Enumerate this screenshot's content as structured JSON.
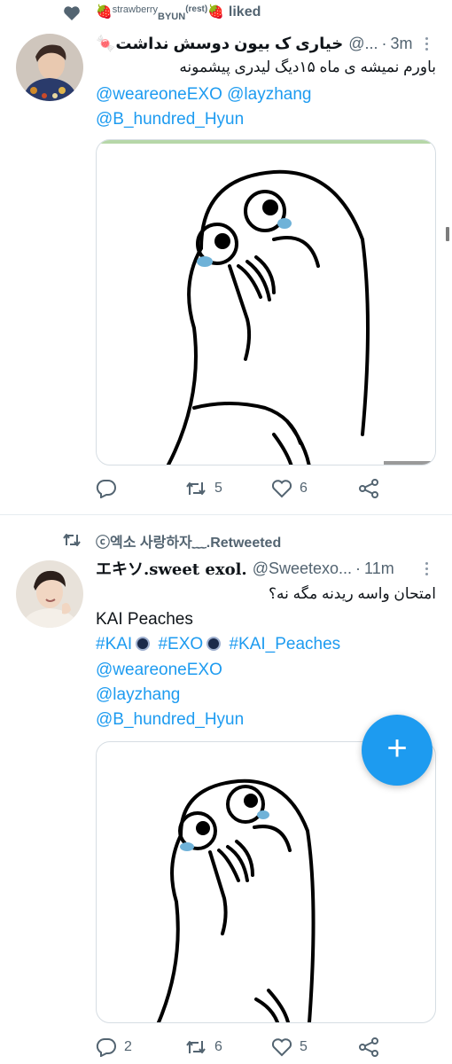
{
  "liked_context": {
    "icon": "heart-icon",
    "text_pre": "strawberry",
    "text_sub": "BYUN",
    "text_sup": "(rest)",
    "text_post": "liked",
    "decoration": "🍓"
  },
  "tweet1": {
    "author_name": "خیاری ک بیون دوسش نداشت🍬",
    "handle": "@...",
    "time": "3m",
    "text_rtl": "باورم نمیشه ی ماه ۱۵دیگ لیدری پیشمونه",
    "mentions_line1": "@weareoneEXO @layzhang",
    "mentions_line2": "@B_hundred_Hyun",
    "replies": "",
    "retweets": "5",
    "likes": "6"
  },
  "retweet_context": {
    "icon": "retweet-icon",
    "text": "ⓒ엑소 사랑하자﹏.Retweeted"
  },
  "tweet2": {
    "author_name": "エキソ.sweet exol.",
    "handle": "@Sweetexo...",
    "time": "11m",
    "text_rtl": "امتحان واسه ریدنه مگه نه؟",
    "line1": "KAI Peaches",
    "hashtag1": "#KAI",
    "hashtag2": "#EXO",
    "hashtag3": "#KAI_Peaches",
    "mention1": "@weareoneEXO",
    "mention2": "@layzhang",
    "mention3": "@B_hundred_Hyun",
    "replies": "2",
    "retweets": "6",
    "likes": "5"
  },
  "colors": {
    "accent": "#1d9bf0",
    "secondary_text": "#536471",
    "divider": "#e6ecf0"
  },
  "fab": {
    "label": "+",
    "icon": "compose-plus-icon"
  }
}
